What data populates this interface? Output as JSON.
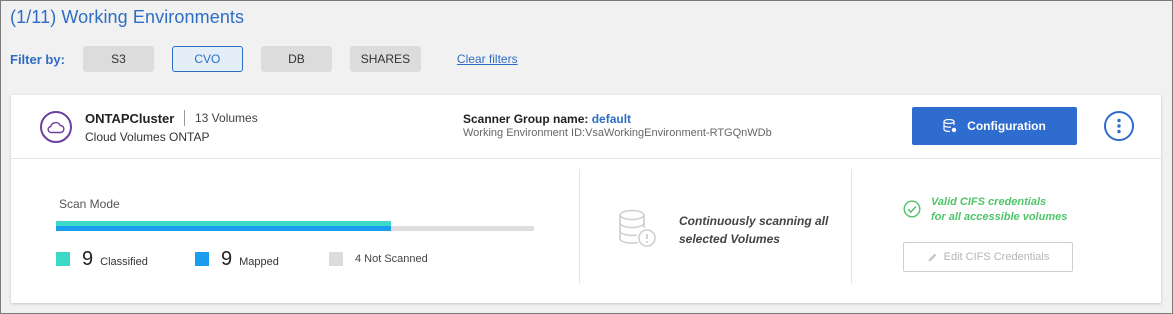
{
  "header": {
    "title": "(1/11) Working Environments"
  },
  "filters": {
    "label": "Filter by:",
    "chips": [
      {
        "label": "S3",
        "active": false
      },
      {
        "label": "CVO",
        "active": true
      },
      {
        "label": "DB",
        "active": false
      },
      {
        "label": "SHARES",
        "active": false
      }
    ],
    "clear_label": "Clear filters"
  },
  "environment": {
    "name": "ONTAPCluster",
    "volumes": "13 Volumes",
    "type": "Cloud Volumes ONTAP",
    "icon": "cloud-icon",
    "scanner_group_label": "Scanner Group name:",
    "scanner_group_value": "default",
    "env_id": "Working Environment ID:VsaWorkingEnvironment-RTGQnWDb",
    "configuration_label": "Configuration",
    "menu_icon": "kebab-icon"
  },
  "scan": {
    "mode_label": "Scan Mode",
    "classified_fraction": 0.7,
    "mapped_fraction": 0.7,
    "legend": {
      "classified_count": "9",
      "classified_label": "Classified",
      "mapped_count": "9",
      "mapped_label": "Mapped",
      "not_scanned_label": "4 Not Scanned"
    },
    "status_text": "Continuously scanning all selected Volumes"
  },
  "cifs": {
    "status_line1": "Valid CIFS credentials",
    "status_line2": "for all accessible volumes",
    "edit_label": "Edit CIFS Credentials"
  },
  "colors": {
    "accent": "#2d6ec4",
    "classified": "#3bd9c6",
    "mapped": "#1a9df0",
    "not_scanned": "#dcdcdc",
    "valid": "#4fc46a",
    "env_icon": "#6b3fa0"
  }
}
